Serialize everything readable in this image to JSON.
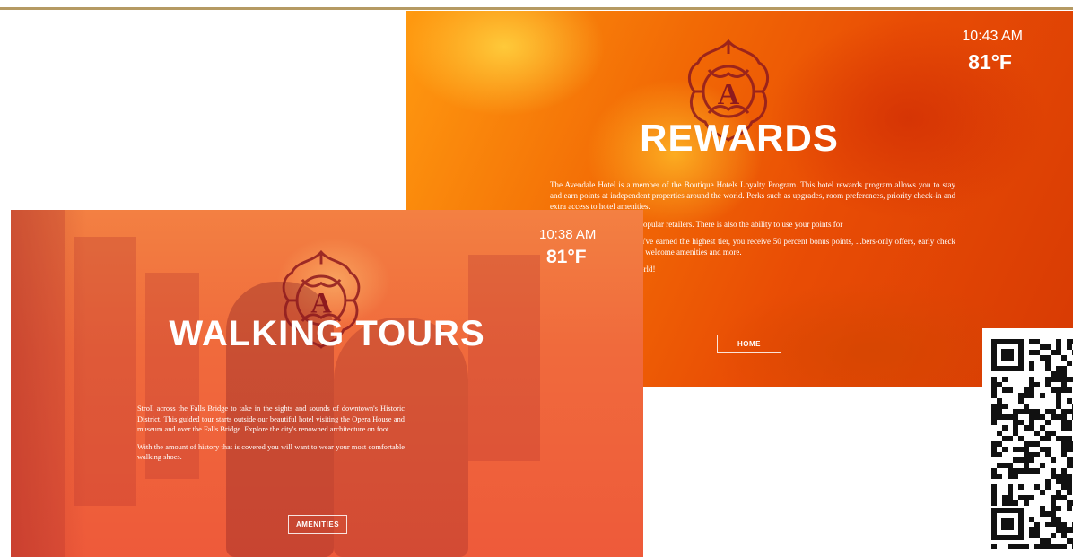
{
  "rewards_screen": {
    "time": "10:43 AM",
    "temperature": "81°F",
    "title": "REWARDS",
    "paragraphs": [
      "The Avendale Hotel is a member of the Boutique Hotels Loyalty Program. This hotel rewards program allows you to stay and earn points at independent properties around the world. Perks such as upgrades, room preferences, priority check-in and extra access to hotel amenities.",
      "...e select airlines and most popular retailers. There is also the ability to use your points for",
      "...embership tiers. When you've earned the highest tier, you receive 50 percent bonus points, ...bers-only offers, early check in and late check out, special welcome amenities and more.",
      "...ating hotels all over the world!"
    ],
    "button_label": "HOME",
    "logo_letter": "A"
  },
  "tours_screen": {
    "time": "10:38 AM",
    "temperature": "81°F",
    "title": "WALKING TOURS",
    "paragraphs": [
      "Stroll across the Falls Bridge to take in the sights and sounds of downtown's Historic District. This guided tour starts outside our beautiful hotel visiting the Opera House and museum and over the Falls Bridge. Explore the city's renowned architecture on foot.",
      "With the amount of history that is covered you will want to wear your most comfortable walking shoes."
    ],
    "button_label": "AMENITIES",
    "logo_letter": "A"
  },
  "colors": {
    "rule": "#b59a63",
    "rewards_bg": "#e94d05",
    "tours_bg": "#f06a3c",
    "logo": "#8e1a1e"
  },
  "icons": [
    "ornamental-a-logo",
    "qr-code"
  ]
}
